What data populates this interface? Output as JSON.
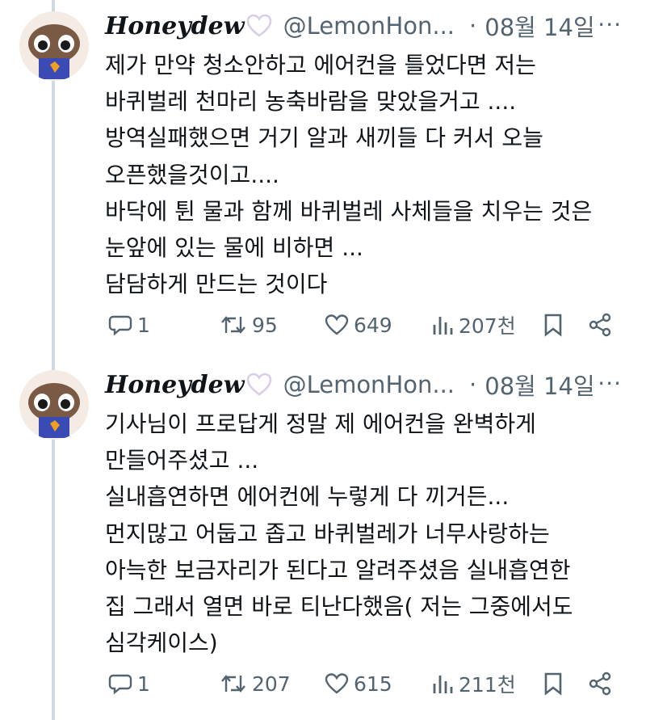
{
  "colors": {
    "text": "#0f1419",
    "muted": "#536471",
    "thread_line": "#cfd9de",
    "heart": "#d9cde8"
  },
  "tweets": [
    {
      "author": {
        "name": "Honeydew",
        "badge_icon": "white-heart-icon",
        "handle": "@LemonHon...",
        "time_separator": "·",
        "time": "08월 14일"
      },
      "more_icon_text": "···",
      "lines": [
        "제가 만약 청소안하고 에어컨을 틀었다면 저는",
        "바퀴벌레 천마리 농축바람을 맞았을거고 ....",
        "방역실패했으면 거기 알과 새끼들 다 커서 오늘",
        "오픈했을것이고....",
        "바닥에 튄 물과 함께 바퀴벌레 사체들을 치우는 것은",
        "눈앞에 있는 물에 비하면 ...",
        "담담하게 만드는 것이다"
      ],
      "stats": {
        "replies": "1",
        "retweets": "95",
        "likes": "649",
        "views": "207천"
      }
    },
    {
      "author": {
        "name": "Honeydew",
        "badge_icon": "white-heart-icon",
        "handle": "@LemonHon...",
        "time_separator": "·",
        "time": "08월 14일"
      },
      "more_icon_text": "···",
      "lines": [
        "기사님이 프로답게 정말 제 에어컨을 완벽하게",
        "만들어주셨고 ...",
        "실내흡연하면 에어컨에 누렇게 다 끼거든...",
        "먼지많고 어둡고 좁고 바퀴벌레가 너무사랑하는",
        "아늑한 보금자리가 된다고 알려주셨음 실내흡연한",
        "집 그래서 열면 바로 티난다했음( 저는 그중에서도",
        "심각케이스)"
      ],
      "stats": {
        "replies": "1",
        "retweets": "207",
        "likes": "615",
        "views": "211천"
      }
    }
  ]
}
